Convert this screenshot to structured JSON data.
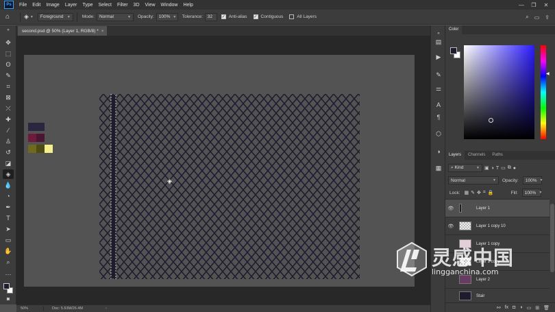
{
  "app": {
    "logo": "Ps"
  },
  "menu": [
    "File",
    "Edit",
    "Image",
    "Layer",
    "Type",
    "Select",
    "Filter",
    "3D",
    "View",
    "Window",
    "Help"
  ],
  "options": {
    "fill_source": "Foreground",
    "mode_label": "Mode:",
    "mode_value": "Normal",
    "opacity_label": "Opacity:",
    "opacity_value": "100%",
    "tolerance_label": "Tolerance:",
    "tolerance_value": "32",
    "antialias_label": "Anti-alias",
    "contiguous_label": "Contiguous",
    "all_layers_label": "All Layers"
  },
  "document": {
    "tab_title": "second.psd @ 50% (Layer 1, RGB/8) *",
    "tab_close": "×"
  },
  "status": {
    "zoom": "50%",
    "doc_size": "Doc: 5.93M/26.4M"
  },
  "swatches": [
    "#2a2640",
    "#6e1a3c",
    "#4a1530",
    "#6d6a1c",
    "#4d4a14",
    "#f6f08a"
  ],
  "color_panel": {
    "tab": "Color",
    "foreground": "#1f1c30",
    "background": "#ffffff"
  },
  "layers_panel": {
    "tabs": [
      "Layers",
      "Channels",
      "Paths"
    ],
    "filter_label": "Kind",
    "blend_mode": "Normal",
    "opacity_label": "Opacity:",
    "opacity_value": "100%",
    "lock_label": "Lock:",
    "fill_label": "Fill:",
    "fill_value": "100%",
    "layers": [
      {
        "name": "Layer 1",
        "visible": true,
        "selected": true
      },
      {
        "name": "Layer 1 copy 10",
        "visible": true,
        "selected": false
      },
      {
        "name": "Layer 1 copy",
        "visible": false,
        "selected": false
      },
      {
        "name": "Layer 1 copy",
        "visible": false,
        "selected": false
      },
      {
        "name": "Layer 2",
        "visible": false,
        "selected": false
      },
      {
        "name": "Stair",
        "visible": false,
        "selected": false
      }
    ]
  },
  "watermark": {
    "cn": "灵感中国",
    "en": "lingganchina.com"
  },
  "colors": {
    "fence": "#1f1c2d",
    "canvas": "#535353",
    "workspace": "#282828"
  }
}
